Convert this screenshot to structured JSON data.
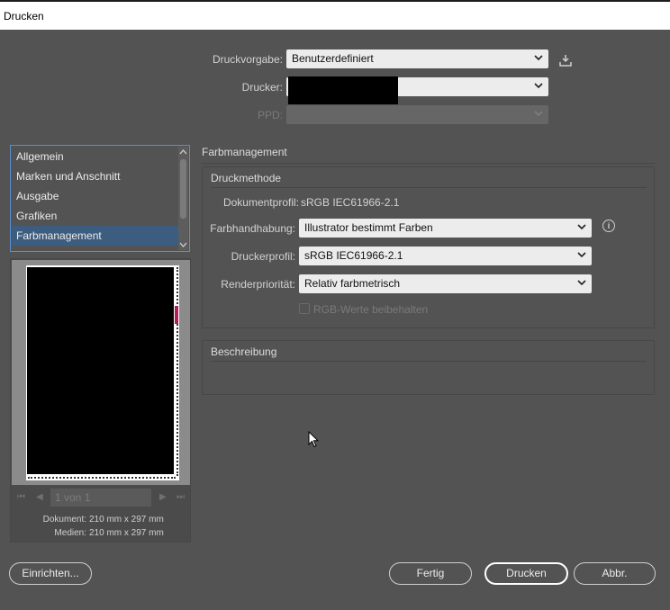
{
  "window": {
    "title": "Drucken"
  },
  "top_settings": {
    "preset_label": "Druckvorgabe:",
    "preset_value": "Benutzerdefiniert",
    "printer_label": "Drucker:",
    "printer_value": "",
    "ppd_label": "PPD:",
    "ppd_value": ""
  },
  "sidebar": {
    "items": [
      {
        "label": "Allgemein"
      },
      {
        "label": "Marken und Anschnitt"
      },
      {
        "label": "Ausgabe"
      },
      {
        "label": "Grafiken"
      },
      {
        "label": "Farbmanagement"
      }
    ],
    "active_index": 4
  },
  "preview": {
    "page_indicator": "1 von 1",
    "document_label": "Dokument:",
    "document_size": "210 mm x 297 mm",
    "media_label": "Medien:",
    "media_size": "210 mm x 297 mm"
  },
  "main": {
    "section_title": "Farbmanagement",
    "print_method_title": "Druckmethode",
    "document_profile_label": "Dokumentprofil:",
    "document_profile_value": "sRGB IEC61966-2.1",
    "color_handling_label": "Farbhandhabung:",
    "color_handling_value": "Illustrator bestimmt Farben",
    "printer_profile_label": "Druckerprofil:",
    "printer_profile_value": "sRGB IEC61966-2.1",
    "render_priority_label": "Renderpriorität:",
    "render_priority_value": "Relativ farbmetrisch",
    "preserve_rgb_label": "RGB-Werte beibehalten",
    "description_title": "Beschreibung"
  },
  "buttons": {
    "setup": "Einrichten...",
    "done": "Fertig",
    "print": "Drucken",
    "cancel": "Abbr."
  }
}
